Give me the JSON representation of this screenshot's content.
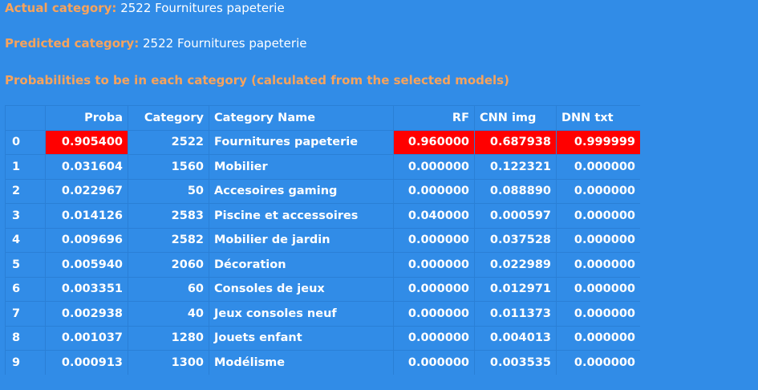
{
  "actual": {
    "label": "Actual category:",
    "value": "2522 Fournitures papeterie"
  },
  "predicted": {
    "label": "Predicted category:",
    "value": "2522 Fournitures papeterie"
  },
  "probabilities_title": "Probabilities to be in each category (calculated from the selected models)",
  "table": {
    "headers": [
      "",
      "Proba",
      "Category",
      "Category Name",
      "RF",
      "CNN img",
      "DNN txt"
    ],
    "rows": [
      [
        "0",
        "0.905400",
        "2522",
        "Fournitures papeterie",
        "0.960000",
        "0.687938",
        "0.999999"
      ],
      [
        "1",
        "0.031604",
        "1560",
        "Mobilier",
        "0.000000",
        "0.122321",
        "0.000000"
      ],
      [
        "2",
        "0.022967",
        "50",
        "Accesoires gaming",
        "0.000000",
        "0.088890",
        "0.000000"
      ],
      [
        "3",
        "0.014126",
        "2583",
        "Piscine et accessoires",
        "0.040000",
        "0.000597",
        "0.000000"
      ],
      [
        "4",
        "0.009696",
        "2582",
        "Mobilier de jardin",
        "0.000000",
        "0.037528",
        "0.000000"
      ],
      [
        "5",
        "0.005940",
        "2060",
        "Décoration",
        "0.000000",
        "0.022989",
        "0.000000"
      ],
      [
        "6",
        "0.003351",
        "60",
        "Consoles de jeux",
        "0.000000",
        "0.012971",
        "0.000000"
      ],
      [
        "7",
        "0.002938",
        "40",
        "Jeux consoles neuf",
        "0.000000",
        "0.011373",
        "0.000000"
      ],
      [
        "8",
        "0.001037",
        "1280",
        "Jouets enfant",
        "0.000000",
        "0.004013",
        "0.000000"
      ],
      [
        "9",
        "0.000913",
        "1300",
        "Modélisme",
        "0.000000",
        "0.003535",
        "0.000000"
      ]
    ]
  },
  "colors": {
    "background": "#318ce7",
    "label": "#f7a35c",
    "highlight": "#ff0000",
    "text": "#ffffff"
  }
}
